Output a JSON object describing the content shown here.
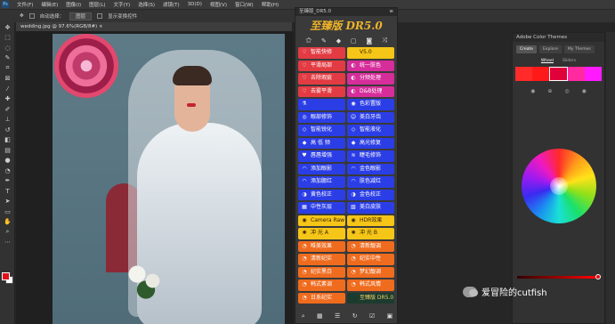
{
  "menubar": {
    "logo": "Ps",
    "items": [
      "文件(F)",
      "编辑(E)",
      "图像(I)",
      "图层(L)",
      "文字(Y)",
      "选择(S)",
      "滤镜(T)",
      "3D(D)",
      "视图(V)",
      "窗口(W)",
      "帮助(H)"
    ]
  },
  "options": {
    "auto_select_label": "自动选择：",
    "auto_select_value": "图层",
    "transform_label": "显示变换控件"
  },
  "document_tab": "wedding.jpg @ 97.6%(RGB/8#) ×",
  "panel": {
    "title": "至臻版_DR5.0",
    "brand": "至臻版 DR5.0",
    "rows": [
      [
        {
          "label": "智能快修",
          "color": "red",
          "icon": "♡"
        },
        {
          "label": "V5.0",
          "color": "yellow",
          "icon": ""
        }
      ],
      [
        {
          "label": "平滑局部",
          "color": "red",
          "icon": "♡"
        },
        {
          "label": "统一肤色",
          "color": "pink",
          "icon": "◐"
        }
      ],
      [
        {
          "label": "去除瑕疵",
          "color": "red",
          "icon": "♡"
        },
        {
          "label": "分频处理",
          "color": "pink",
          "icon": "◐"
        }
      ],
      [
        {
          "label": "去雾平滑",
          "color": "red",
          "icon": "♡"
        },
        {
          "label": "D&B处理",
          "color": "pink",
          "icon": "◐"
        }
      ],
      [
        {
          "label": "",
          "color": "blue",
          "icon": "⚗"
        },
        {
          "label": "色彩置版",
          "color": "blue",
          "icon": "◉"
        }
      ],
      [
        {
          "label": "眼部修饰",
          "color": "blue",
          "icon": "◎"
        },
        {
          "label": "美白牙齿",
          "color": "blue",
          "icon": "☺"
        }
      ],
      [
        {
          "label": "智能锐化",
          "color": "blue",
          "icon": "◇"
        },
        {
          "label": "智能液化",
          "color": "blue",
          "icon": "◇"
        }
      ],
      [
        {
          "label": "高 低 频",
          "color": "blue",
          "icon": "◆"
        },
        {
          "label": "高光修复",
          "color": "blue",
          "icon": "◆"
        }
      ],
      [
        {
          "label": "唇唇增强",
          "color": "blue",
          "icon": "♥"
        },
        {
          "label": "睫毛修饰",
          "color": "blue",
          "icon": "≋"
        }
      ],
      [
        {
          "label": "添加眼影",
          "color": "blue",
          "icon": "◠"
        },
        {
          "label": "金色眼影",
          "color": "blue",
          "icon": "◠"
        }
      ],
      [
        {
          "label": "添加腮红",
          "color": "blue",
          "icon": "◠"
        },
        {
          "label": "肤色减红",
          "color": "blue",
          "icon": "◠"
        }
      ],
      [
        {
          "label": "黄色校正",
          "color": "blue",
          "icon": "◑"
        },
        {
          "label": "金色校正",
          "color": "blue",
          "icon": "◑"
        }
      ],
      [
        {
          "label": "中性灰层",
          "color": "blue",
          "icon": "▦"
        },
        {
          "label": "美白皮肤",
          "color": "blue",
          "icon": "▧"
        }
      ],
      [
        {
          "label": "Camera Raw",
          "color": "yellow",
          "icon": "◉"
        },
        {
          "label": "HDR效果",
          "color": "yellow",
          "icon": "◉"
        }
      ],
      [
        {
          "label": "冲 光 A",
          "color": "yellow",
          "icon": "✺"
        },
        {
          "label": "冲 光 B",
          "color": "yellow",
          "icon": "✺"
        }
      ],
      [
        {
          "label": "唯美效果",
          "color": "orange",
          "icon": "◔"
        },
        {
          "label": "清新靓调",
          "color": "orange",
          "icon": "◔"
        }
      ],
      [
        {
          "label": "清新纪实",
          "color": "orange",
          "icon": "◔"
        },
        {
          "label": "纪实中性",
          "color": "orange",
          "icon": "◔"
        }
      ],
      [
        {
          "label": "纪实黑白",
          "color": "orange",
          "icon": "◔"
        },
        {
          "label": "梦幻靓调",
          "color": "orange",
          "icon": "◔"
        }
      ],
      [
        {
          "label": "韩式素调",
          "color": "orange",
          "icon": "◔"
        },
        {
          "label": "韩式风情",
          "color": "orange",
          "icon": "◔"
        }
      ],
      [
        {
          "label": "日系纪实",
          "color": "orange",
          "icon": "◔"
        },
        {
          "label": "至臻版 DR5.0",
          "color": "dark",
          "icon": ""
        }
      ]
    ]
  },
  "color_themes": {
    "title": "Adobe Color Themes",
    "tabs": [
      "Create",
      "Explore",
      "My Themes"
    ],
    "modes": [
      "Wheel",
      "Sliders"
    ],
    "palette": [
      "#ff2a2a",
      "#ff1a1a",
      "#e0003a",
      "#ff2aa0",
      "#ff1aff"
    ]
  },
  "watermark": "爱冒险的cutfish"
}
